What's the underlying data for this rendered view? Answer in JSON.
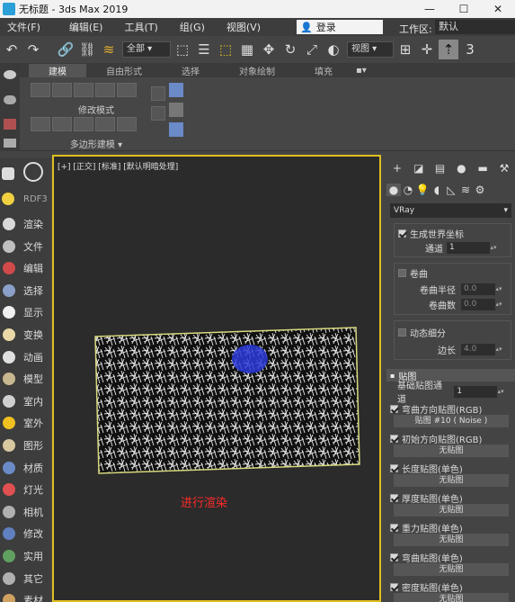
{
  "window": {
    "title": "无标题 - 3ds Max 2019",
    "minimize": "—",
    "maximize": "☐",
    "close": "✕"
  },
  "menu": {
    "items": [
      "文件(F)",
      "编辑(E)",
      "工具(T)",
      "组(G)",
      "视图(V)"
    ],
    "login": "登录",
    "workspace_label": "工作区:",
    "workspace_value": "默认"
  },
  "toolbar": {
    "filter_select": "全部",
    "view_select": "视图"
  },
  "ribbon": {
    "tabs": [
      "建模",
      "自由形式",
      "选择",
      "对象绘制",
      "填充"
    ],
    "active_tab": 0,
    "modify_mode": "修改模式",
    "poly_modeling": "多边形建模 ▾"
  },
  "left_toolbar": {
    "rdf_label": "RDF3",
    "items": [
      {
        "label": "渲染",
        "color": "#d9d9d9"
      },
      {
        "label": "文件",
        "color": "#bfbfbf"
      },
      {
        "label": "编辑",
        "color": "#d04a4a"
      },
      {
        "label": "选择",
        "color": "#8aa0c8"
      },
      {
        "label": "显示",
        "color": "#f0f0f0"
      },
      {
        "label": "变换",
        "color": "#e8d8a8"
      },
      {
        "label": "动画",
        "color": "#e0e0e0"
      },
      {
        "label": "模型",
        "color": "#c8b890"
      },
      {
        "label": "室内",
        "color": "#d0d0d0"
      },
      {
        "label": "室外",
        "color": "#f0c020"
      },
      {
        "label": "图形",
        "color": "#d8c8a0"
      },
      {
        "label": "材质",
        "color": "#6a8ac8"
      },
      {
        "label": "灯光",
        "color": "#e05050"
      },
      {
        "label": "相机",
        "color": "#b0b0b0"
      },
      {
        "label": "修改",
        "color": "#6080c0"
      },
      {
        "label": "实用",
        "color": "#60a060"
      },
      {
        "label": "其它",
        "color": "#b0b0b0"
      },
      {
        "label": "素材",
        "color": "#d0a060"
      }
    ]
  },
  "viewport": {
    "label": "[+] [正交] [标准] [默认明暗处理]",
    "overlay_text": "进行渲染"
  },
  "command_panel": {
    "renderer_select": "VRay",
    "world_coords": "生成世界坐标",
    "channel_label": "通道",
    "channel_value": "1",
    "curl_label": "卷曲",
    "curl_radius_label": "卷曲半径",
    "curl_radius_value": "0.0",
    "curl_count_label": "卷曲数",
    "curl_count_value": "0.0",
    "dynamic_subdiv": "动态细分",
    "edge_length_label": "边长",
    "edge_length_value": "4.0",
    "maps_header": "贴图",
    "base_map_channel_label": "基础贴图通道",
    "base_map_channel_value": "1",
    "maps": [
      {
        "label": "弯曲方向贴图(RGB)",
        "slot": "贴图 #10  ( Noise )"
      },
      {
        "label": "初始方向贴图(RGB)",
        "slot": "无贴图"
      },
      {
        "label": "长度贴图(单色)",
        "slot": "无贴图"
      },
      {
        "label": "厚度贴图(单色)",
        "slot": "无贴图"
      },
      {
        "label": "重力贴图(单色)",
        "slot": "无贴图"
      },
      {
        "label": "弯曲贴图(单色)",
        "slot": "无贴图"
      },
      {
        "label": "密度贴图(单色)",
        "slot": "无贴图"
      }
    ]
  }
}
